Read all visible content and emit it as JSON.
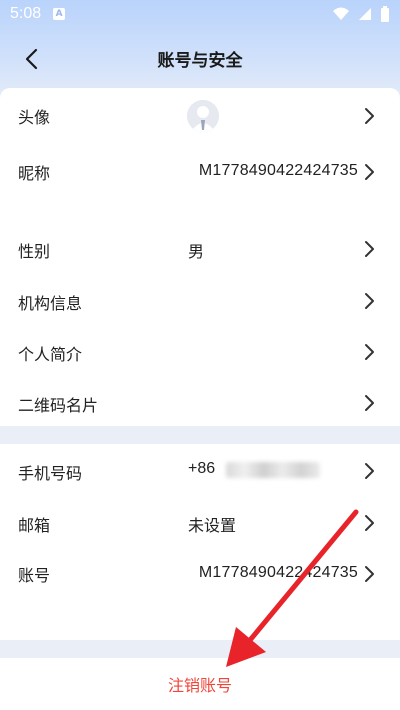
{
  "status_bar": {
    "time": "5:08",
    "a_label": "A"
  },
  "header": {
    "title": "账号与安全"
  },
  "profile": {
    "avatar_label": "头像",
    "nickname_label": "昵称",
    "nickname_value": "M1778490422424735",
    "gender_label": "性别",
    "gender_value": "男",
    "org_label": "机构信息",
    "bio_label": "个人简介",
    "qrcode_label": "二维码名片"
  },
  "account": {
    "phone_label": "手机号码",
    "phone_prefix": "+86",
    "email_label": "邮箱",
    "email_value": "未设置",
    "account_label": "账号",
    "account_value": "M1778490422424735"
  },
  "actions": {
    "logout_label": "注销账号"
  },
  "colors": {
    "accent_red": "#f0453a",
    "annotation_arrow": "#e8232a"
  }
}
